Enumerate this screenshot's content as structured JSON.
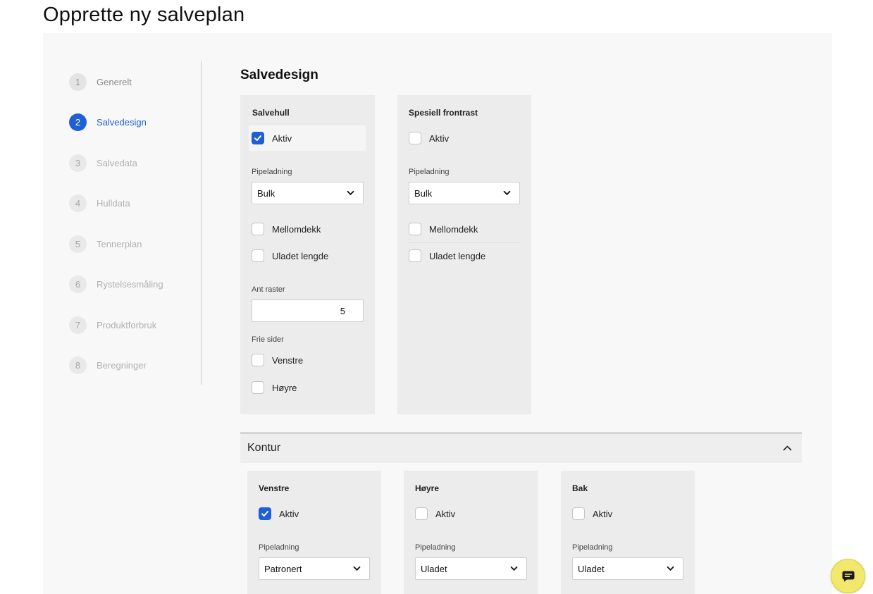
{
  "page": {
    "title": "Opprette ny salveplan"
  },
  "stepper": {
    "steps": [
      {
        "num": "1",
        "label": "Generelt"
      },
      {
        "num": "2",
        "label": "Salvedesign"
      },
      {
        "num": "3",
        "label": "Salvedata"
      },
      {
        "num": "4",
        "label": "Hulldata"
      },
      {
        "num": "5",
        "label": "Tennerplan"
      },
      {
        "num": "6",
        "label": "Rystelsesmåling"
      },
      {
        "num": "7",
        "label": "Produktforbruk"
      },
      {
        "num": "8",
        "label": "Beregninger"
      }
    ],
    "active_step": 2
  },
  "section": {
    "title": "Salvedesign"
  },
  "salvehull": {
    "title": "Salvehull",
    "aktiv": {
      "label": "Aktiv",
      "checked": true
    },
    "pipeladning": {
      "label": "Pipeladning",
      "value": "Bulk"
    },
    "mellomdekk": {
      "label": "Mellomdekk",
      "checked": false
    },
    "uladet_lengde": {
      "label": "Uladet lengde",
      "checked": false
    },
    "ant_raster": {
      "label": "Ant raster",
      "value": "5"
    },
    "frie_sider": {
      "label": "Frie sider"
    },
    "venstre": {
      "label": "Venstre",
      "checked": false
    },
    "hoyre": {
      "label": "Høyre",
      "checked": false
    }
  },
  "frontrast": {
    "title": "Spesiell frontrast",
    "aktiv": {
      "label": "Aktiv",
      "checked": false
    },
    "pipeladning": {
      "label": "Pipeladning",
      "value": "Bulk"
    },
    "mellomdekk": {
      "label": "Mellomdekk",
      "checked": false
    },
    "uladet_lengde": {
      "label": "Uladet lengde",
      "checked": false
    }
  },
  "kontur": {
    "title": "Kontur",
    "expanded": true,
    "venstre": {
      "title": "Venstre",
      "aktiv": {
        "label": "Aktiv",
        "checked": true
      },
      "pipeladning": {
        "label": "Pipeladning",
        "value": "Patronert"
      }
    },
    "hoyre": {
      "title": "Høyre",
      "aktiv": {
        "label": "Aktiv",
        "checked": false
      },
      "pipeladning": {
        "label": "Pipeladning",
        "value": "Uladet"
      }
    },
    "bak": {
      "title": "Bak",
      "aktiv": {
        "label": "Aktiv",
        "checked": false
      },
      "pipeladning": {
        "label": "Pipeladning",
        "value": "Uladet"
      }
    }
  },
  "colors": {
    "accent": "#1f5fd6",
    "chat_button": "#f1e86b"
  },
  "icons": {
    "chat": "chat-bubble-icon",
    "chevron": "chevron-down-icon",
    "collapse": "chevron-up-icon",
    "check": "checkmark-icon"
  }
}
